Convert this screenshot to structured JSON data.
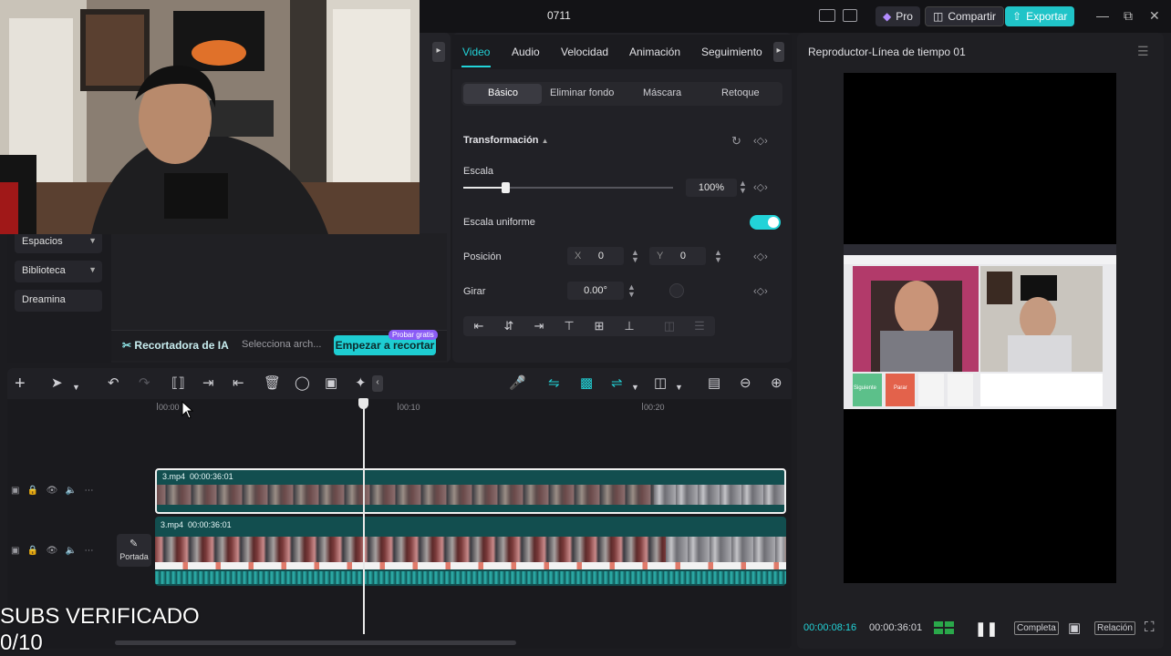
{
  "titlebar": {
    "doc_title": "0711",
    "pro_label": "Pro",
    "share_label": "Compartir",
    "export_label": "Exportar"
  },
  "left_panel": {
    "categories": [
      "Espacios",
      "Biblioteca",
      "Dreamina"
    ],
    "ai_cutter_label": "Recortadora de IA",
    "ai_select_label": "Selecciona arch...",
    "ai_start_label": "Empezar a recortar",
    "ai_badge": "Probar gratis"
  },
  "properties": {
    "tabs": [
      "Video",
      "Audio",
      "Velocidad",
      "Animación",
      "Seguimiento"
    ],
    "active_tab": "Video",
    "subtabs": [
      "Básico",
      "Eliminar fondo",
      "Máscara",
      "Retoque"
    ],
    "section_title": "Transformación",
    "scale_label": "Escala",
    "scale_value": "100%",
    "scale_level": 0.2,
    "uniform_scale_label": "Escala uniforme",
    "uniform_scale_on": true,
    "position_label": "Posición",
    "pos_x_label": "X",
    "pos_x": "0",
    "pos_y_label": "Y",
    "pos_y": "0",
    "rotate_label": "Girar",
    "rotate_value": "0.00°"
  },
  "player": {
    "title": "Reproductor-Línea de tiempo 01",
    "current_time": "00:00:08:16",
    "duration": "00:00:36:01",
    "full_label": "Completa",
    "ratio_label": "Relación",
    "inner_buttons": [
      "Siguiente",
      "Parar"
    ]
  },
  "timeline": {
    "ruler_labels": [
      "00:00",
      "00:10",
      "00:20"
    ],
    "clip1_name": "3.mp4",
    "clip1_duration": "00:00:36:01",
    "clip2_name": "3.mp4",
    "clip2_duration": "00:00:36:01",
    "cover_label": "Portada",
    "playhead_time": "00:00:08:16"
  },
  "overlay": {
    "line1": "SUBS VERIFICADO",
    "line2": "0/10"
  },
  "colors": {
    "accent": "#22d3d8",
    "export": "#20c4c8",
    "clip": "#124e4f"
  }
}
